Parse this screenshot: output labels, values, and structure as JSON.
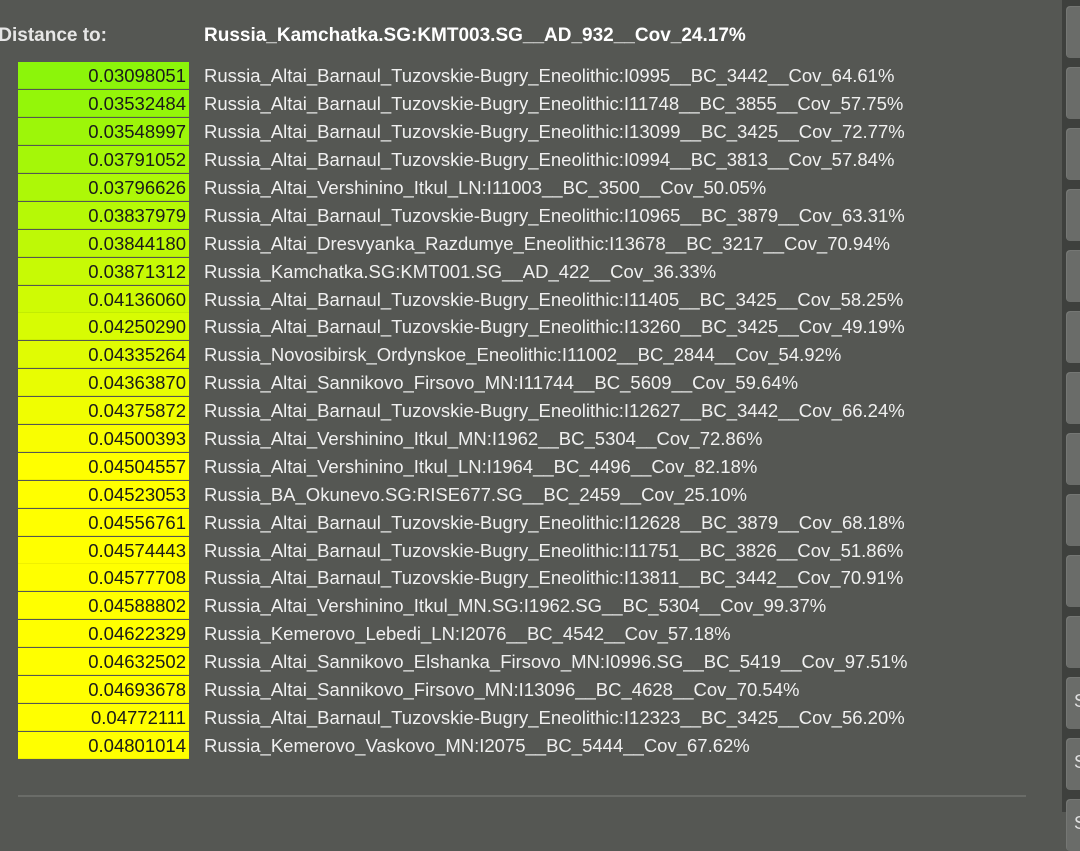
{
  "header": {
    "label": "Distance to:",
    "target": "Russia_Kamchatka.SG:KMT003.SG__AD_932__Cov_24.17%"
  },
  "colors": {
    "background": "#555753",
    "cell_start": "#8cf50a",
    "cell_end": "#ffff00",
    "text": "#f0f0f0"
  },
  "rows": [
    {
      "distance": "0.03098051",
      "name": "Russia_Altai_Barnaul_Tuzovskie-Bugry_Eneolithic:I0995__BC_3442__Cov_64.61%"
    },
    {
      "distance": "0.03532484",
      "name": "Russia_Altai_Barnaul_Tuzovskie-Bugry_Eneolithic:I11748__BC_3855__Cov_57.75%"
    },
    {
      "distance": "0.03548997",
      "name": "Russia_Altai_Barnaul_Tuzovskie-Bugry_Eneolithic:I13099__BC_3425__Cov_72.77%"
    },
    {
      "distance": "0.03791052",
      "name": "Russia_Altai_Barnaul_Tuzovskie-Bugry_Eneolithic:I0994__BC_3813__Cov_57.84%"
    },
    {
      "distance": "0.03796626",
      "name": "Russia_Altai_Vershinino_Itkul_LN:I11003__BC_3500__Cov_50.05%"
    },
    {
      "distance": "0.03837979",
      "name": "Russia_Altai_Barnaul_Tuzovskie-Bugry_Eneolithic:I10965__BC_3879__Cov_63.31%"
    },
    {
      "distance": "0.03844180",
      "name": "Russia_Altai_Dresvyanka_Razdumye_Eneolithic:I13678__BC_3217__Cov_70.94%"
    },
    {
      "distance": "0.03871312",
      "name": "Russia_Kamchatka.SG:KMT001.SG__AD_422__Cov_36.33%"
    },
    {
      "distance": "0.04136060",
      "name": "Russia_Altai_Barnaul_Tuzovskie-Bugry_Eneolithic:I11405__BC_3425__Cov_58.25%"
    },
    {
      "distance": "0.04250290",
      "name": "Russia_Altai_Barnaul_Tuzovskie-Bugry_Eneolithic:I13260__BC_3425__Cov_49.19%"
    },
    {
      "distance": "0.04335264",
      "name": "Russia_Novosibirsk_Ordynskoe_Eneolithic:I11002__BC_2844__Cov_54.92%"
    },
    {
      "distance": "0.04363870",
      "name": "Russia_Altai_Sannikovo_Firsovo_MN:I11744__BC_5609__Cov_59.64%"
    },
    {
      "distance": "0.04375872",
      "name": "Russia_Altai_Barnaul_Tuzovskie-Bugry_Eneolithic:I12627__BC_3442__Cov_66.24%"
    },
    {
      "distance": "0.04500393",
      "name": "Russia_Altai_Vershinino_Itkul_MN:I1962__BC_5304__Cov_72.86%"
    },
    {
      "distance": "0.04504557",
      "name": "Russia_Altai_Vershinino_Itkul_LN:I1964__BC_4496__Cov_82.18%"
    },
    {
      "distance": "0.04523053",
      "name": "Russia_BA_Okunevo.SG:RISE677.SG__BC_2459__Cov_25.10%"
    },
    {
      "distance": "0.04556761",
      "name": "Russia_Altai_Barnaul_Tuzovskie-Bugry_Eneolithic:I12628__BC_3879__Cov_68.18%"
    },
    {
      "distance": "0.04574443",
      "name": "Russia_Altai_Barnaul_Tuzovskie-Bugry_Eneolithic:I11751__BC_3826__Cov_51.86%"
    },
    {
      "distance": "0.04577708",
      "name": "Russia_Altai_Barnaul_Tuzovskie-Bugry_Eneolithic:I13811__BC_3442__Cov_70.91%"
    },
    {
      "distance": "0.04588802",
      "name": "Russia_Altai_Vershinino_Itkul_MN.SG:I1962.SG__BC_5304__Cov_99.37%"
    },
    {
      "distance": "0.04622329",
      "name": "Russia_Kemerovo_Lebedi_LN:I2076__BC_4542__Cov_57.18%"
    },
    {
      "distance": "0.04632502",
      "name": "Russia_Altai_Sannikovo_Elshanka_Firsovo_MN:I0996.SG__BC_5419__Cov_97.51%"
    },
    {
      "distance": "0.04693678",
      "name": "Russia_Altai_Sannikovo_Firsovo_MN:I13096__BC_4628__Cov_70.54%"
    },
    {
      "distance": "0.04772111",
      "name": "Russia_Altai_Barnaul_Tuzovskie-Bugry_Eneolithic:I12323__BC_3425__Cov_56.20%"
    },
    {
      "distance": "0.04801014",
      "name": "Russia_Kemerovo_Vaskovo_MN:I2075__BC_5444__Cov_67.62%"
    }
  ],
  "sidebar": {
    "buttons": [
      "",
      "",
      "",
      "",
      "",
      "",
      "",
      "",
      "",
      "",
      "",
      "S",
      "S",
      "S"
    ]
  }
}
